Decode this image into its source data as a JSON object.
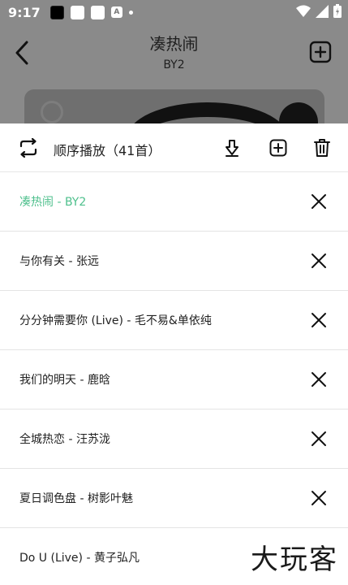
{
  "status_bar": {
    "time": "9:17"
  },
  "player": {
    "song_title": "凑热闹",
    "artist": "BY2"
  },
  "playlist": {
    "mode_label": "顺序播放（41首）",
    "accent_color": "#4fc08d",
    "tracks": [
      {
        "text": "凑热闹 - BY2",
        "active": true
      },
      {
        "text": "与你有关 - 张远",
        "active": false
      },
      {
        "text": "分分钟需要你 (Live) - 毛不易&单依纯",
        "active": false
      },
      {
        "text": "我们的明天 - 鹿晗",
        "active": false
      },
      {
        "text": "全城热恋 - 汪苏泷",
        "active": false
      },
      {
        "text": "夏日调色盘 - 树影叶魅",
        "active": false
      },
      {
        "text": "Do U (Live) - 黄子弘凡",
        "active": false
      }
    ]
  },
  "watermark": "大玩客",
  "icons": {
    "back": "chevron-left-icon",
    "add_to_list": "plus-square-icon",
    "play_mode": "repeat-icon",
    "download": "download-icon",
    "delete": "trash-icon",
    "remove": "close-icon"
  }
}
